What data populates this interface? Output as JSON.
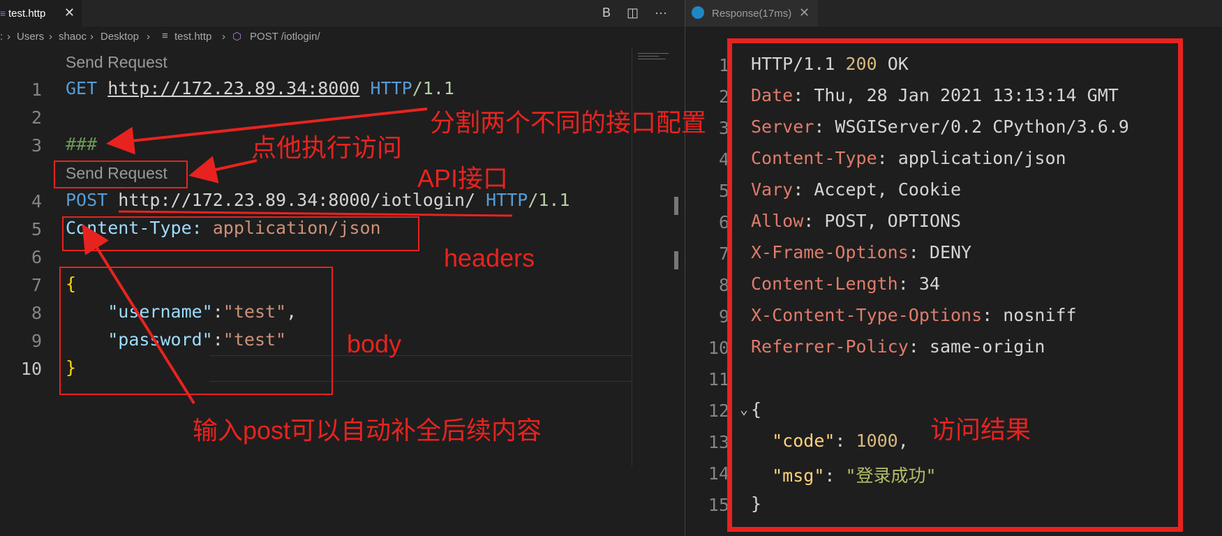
{
  "editor": {
    "tab": {
      "label": "test.http",
      "close": "✕"
    },
    "toolbar": {
      "b": "B",
      "split": "◫",
      "more": "···"
    },
    "breadcrumb": {
      "parts": [
        ":",
        "Users",
        "shaoc",
        "Desktop"
      ],
      "file": "test.http",
      "request": "POST /iotlogin/"
    },
    "lens1": "Send Request",
    "lens2": "Send Request",
    "line_numbers": [
      "1",
      "2",
      "3",
      "4",
      "5",
      "6",
      "7",
      "8",
      "9",
      "10"
    ],
    "line1": {
      "method": "GET",
      "url": "http://172.23.89.34:8000",
      "proto": "HTTP",
      "ver": "/1.1"
    },
    "line3": "###",
    "line4": {
      "method": "POST",
      "url": "http://172.23.89.34:8000/iotlogin/",
      "proto": "HTTP",
      "ver": "/1.1"
    },
    "line5": {
      "name": "Content-Type:",
      "value": "application/json"
    },
    "line7": "{",
    "line8": {
      "key": "\"username\"",
      "colon": ":",
      "value": "\"test\"",
      "comma": ","
    },
    "line9": {
      "key": "\"password\"",
      "colon": ":",
      "value": "\"test\""
    },
    "line10": "}"
  },
  "response": {
    "tab": {
      "label": "Response(17ms)",
      "close": "✕"
    },
    "line_numbers": [
      "1",
      "2",
      "3",
      "4",
      "5",
      "6",
      "7",
      "8",
      "9",
      "10",
      "11",
      "12",
      "13",
      "14",
      "15"
    ],
    "status": {
      "proto": "HTTP/1.1",
      "code": "200",
      "text": "OK"
    },
    "headers": [
      {
        "name": "Date",
        "value": "Thu, 28 Jan 2021 13:13:14 GMT"
      },
      {
        "name": "Server",
        "value": "WSGIServer/0.2 CPython/3.6.9"
      },
      {
        "name": "Content-Type",
        "value": "application/json"
      },
      {
        "name": "Vary",
        "value": "Accept, Cookie"
      },
      {
        "name": "Allow",
        "value": "POST, OPTIONS"
      },
      {
        "name": "X-Frame-Options",
        "value": "DENY"
      },
      {
        "name": "Content-Length",
        "value": "34"
      },
      {
        "name": "X-Content-Type-Options",
        "value": "nosniff"
      },
      {
        "name": "Referrer-Policy",
        "value": "same-origin"
      }
    ],
    "body": {
      "open": "{",
      "code_key": "\"code\"",
      "code_val": "1000",
      "msg_key": "\"msg\"",
      "msg_val": "\"登录成功\"",
      "close": "}"
    }
  },
  "annotations": {
    "split": "分割两个不同的接口配置",
    "click": "点他执行访问",
    "api": "API接口",
    "headers": "headers",
    "body": "body",
    "autocomplete": "输入post可以自动补全后续内容",
    "result": "访问结果"
  },
  "colors": {
    "annotation": "#e8231f",
    "keyword": "#569cd6",
    "status_code": "#d7ba7d"
  }
}
